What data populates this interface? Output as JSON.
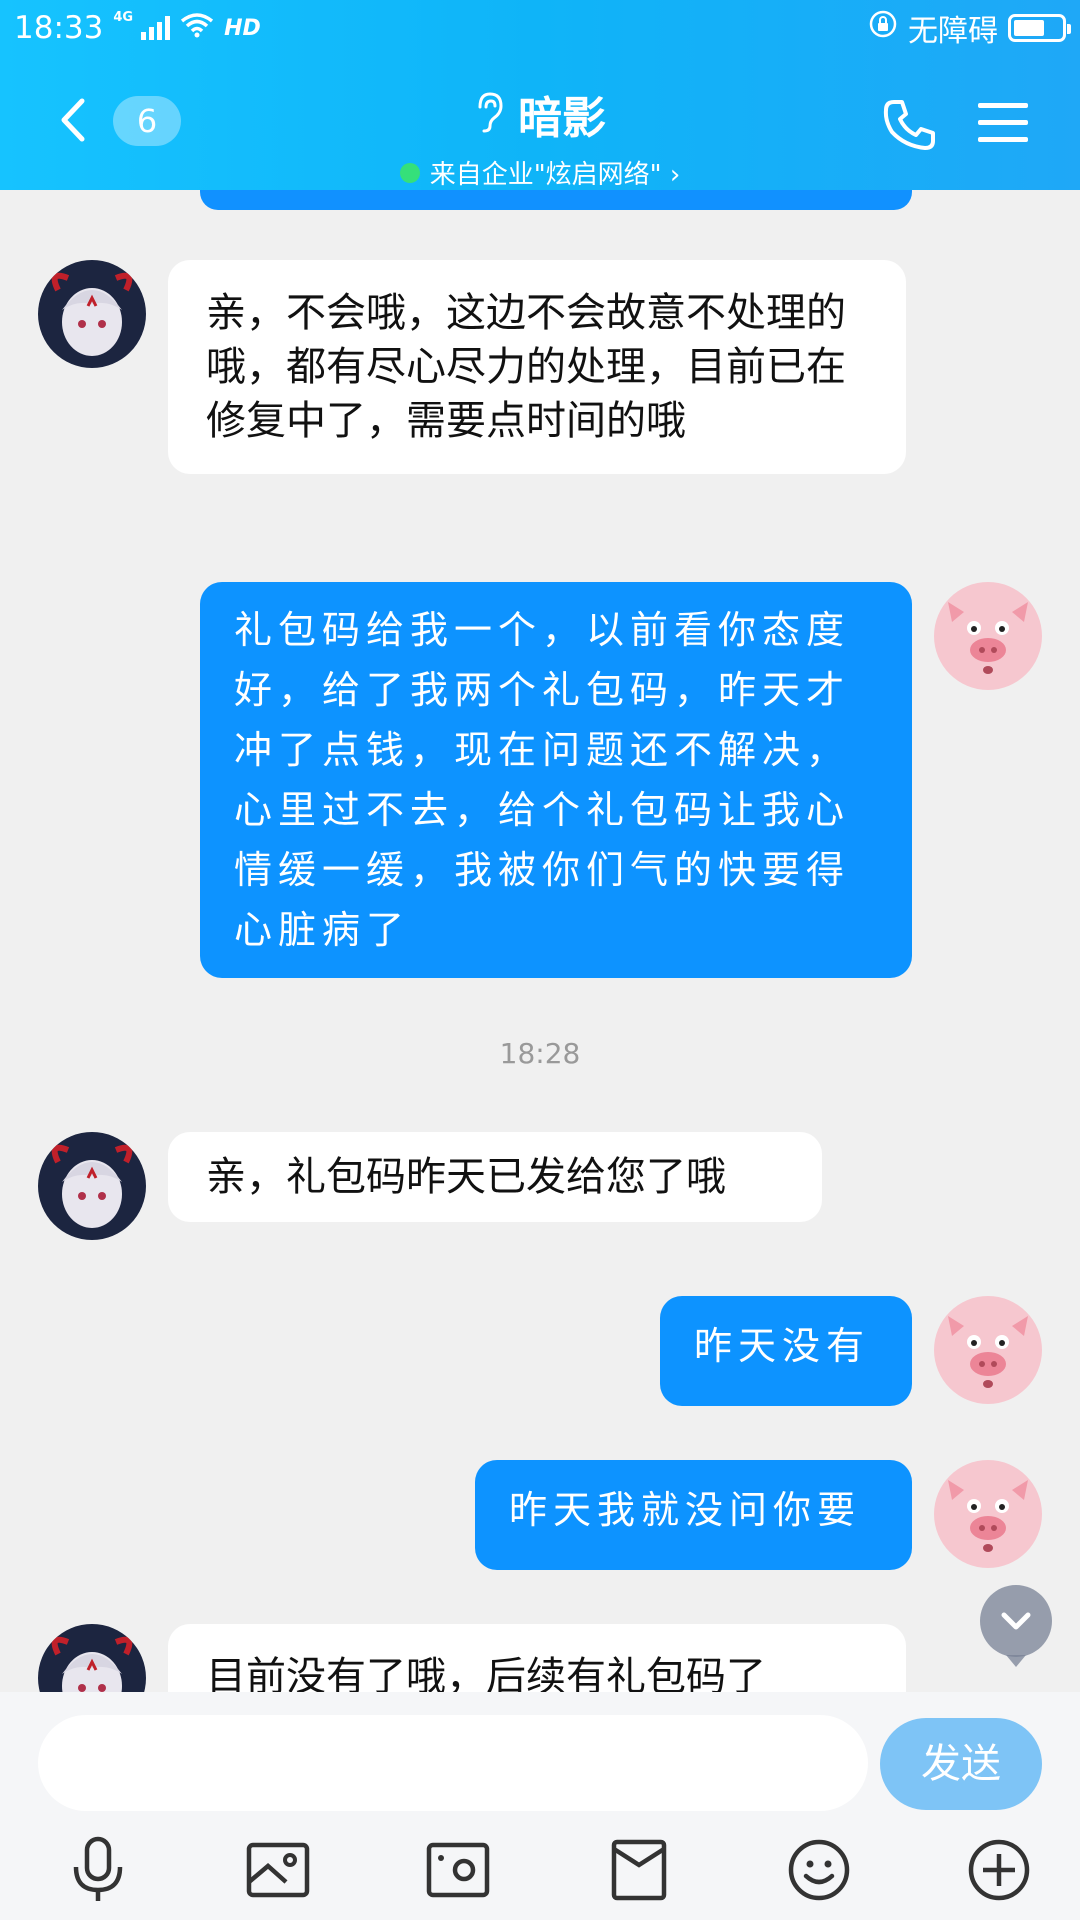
{
  "status_bar": {
    "time": "18:33",
    "network_tag": "4G",
    "hd_label": "HD",
    "accessibility_label": "无障碍",
    "battery_level": 0.65
  },
  "header": {
    "unread_count": "6",
    "contact_name": "暗影",
    "subtitle": "来自企业\"炫启网络\" ›"
  },
  "messages": [
    {
      "direction": "in",
      "text": "亲，不会哦，这边不会故意不处理的哦，都有尽心尽力的处理，目前已在修复中了，需要点时间的哦"
    },
    {
      "direction": "out",
      "text": "礼包码给我一个，以前看你态度好，给了我两个礼包码，昨天才冲了点钱，现在问题还不解决，心里过不去，给个礼包码让我心情缓一缓，我被你们气的快要得心脏病了"
    },
    {
      "direction": "time",
      "text": "18:28"
    },
    {
      "direction": "in",
      "text": "亲，礼包码昨天已发给您了哦"
    },
    {
      "direction": "out",
      "text": "昨天没有"
    },
    {
      "direction": "out",
      "text": "昨天我就没问你要"
    },
    {
      "direction": "in",
      "text": "目前没有了哦，后续有礼包码了"
    }
  ],
  "composer": {
    "placeholder": "",
    "send_label": "发送"
  },
  "toolbar": {
    "icons": [
      "microphone-icon",
      "image-icon",
      "camera-icon",
      "red-packet-icon",
      "emoji-icon",
      "plus-icon"
    ]
  },
  "colors": {
    "header_blue": "#16c3ff",
    "outgoing_bubble": "#0d93ff",
    "incoming_bubble": "#ffffff",
    "send_button": "#7ec4f6",
    "online_dot": "#35e07a"
  }
}
